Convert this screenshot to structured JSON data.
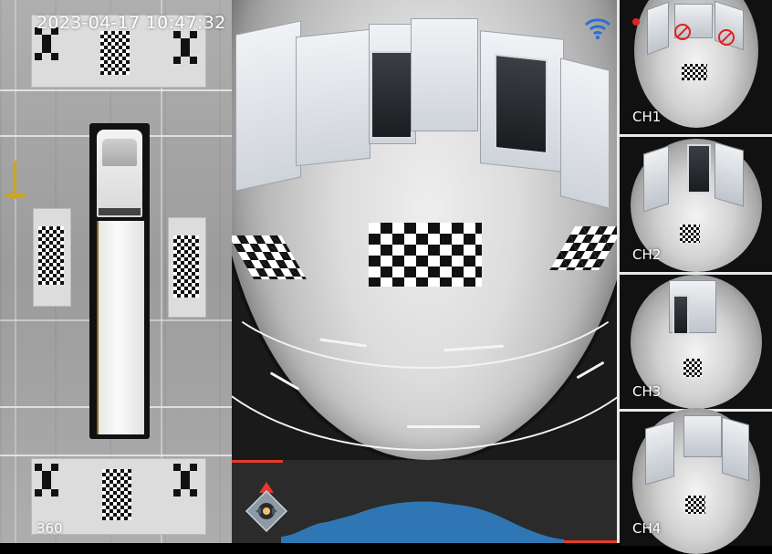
{
  "birdseye": {
    "timestamp": "2023-04-17 10:47:32",
    "view_label": "360"
  },
  "main_view": {
    "status_icons": [
      "wifi-icon"
    ]
  },
  "channels": [
    {
      "label": "CH1"
    },
    {
      "label": "CH2"
    },
    {
      "label": "CH3"
    },
    {
      "label": "CH4"
    }
  ],
  "colors": {
    "radar_wave": "#2f77b4",
    "radar_bar_bg": "#2b2b2b",
    "alert_red": "#e53a2b",
    "wifi_blue": "#2a6fd6",
    "overlay_text": "#ffffff"
  }
}
